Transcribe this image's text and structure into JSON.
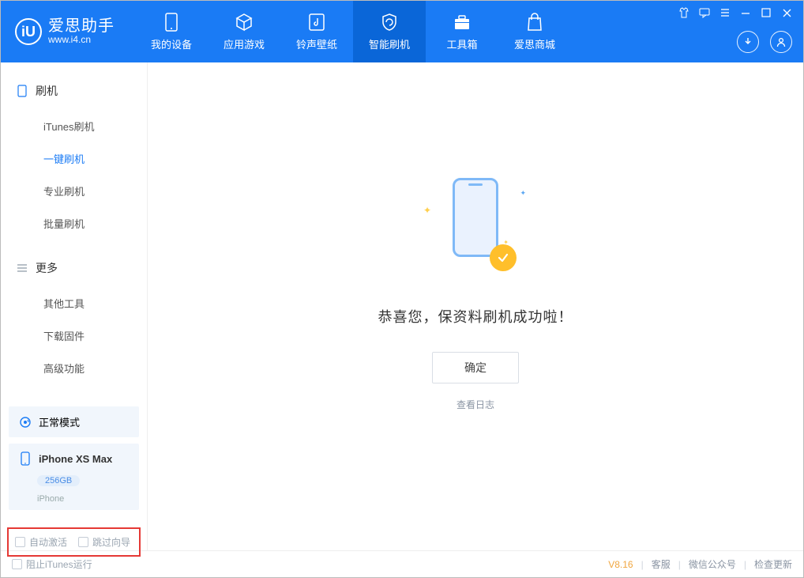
{
  "app": {
    "name": "爱思助手",
    "url": "www.i4.cn"
  },
  "nav": {
    "items": [
      {
        "label": "我的设备"
      },
      {
        "label": "应用游戏"
      },
      {
        "label": "铃声壁纸"
      },
      {
        "label": "智能刷机"
      },
      {
        "label": "工具箱"
      },
      {
        "label": "爱思商城"
      }
    ]
  },
  "sidebar": {
    "section1_title": "刷机",
    "section1_items": [
      "iTunes刷机",
      "一键刷机",
      "专业刷机",
      "批量刷机"
    ],
    "section2_title": "更多",
    "section2_items": [
      "其他工具",
      "下载固件",
      "高级功能"
    ]
  },
  "device": {
    "mode": "正常模式",
    "name": "iPhone XS Max",
    "storage": "256GB",
    "type": "iPhone"
  },
  "options": {
    "auto_activate": "自动激活",
    "skip_guide": "跳过向导"
  },
  "main": {
    "success": "恭喜您，保资料刷机成功啦！",
    "ok": "确定",
    "view_log": "查看日志"
  },
  "footer": {
    "block_itunes": "阻止iTunes运行",
    "version": "V8.16",
    "support": "客服",
    "wechat": "微信公众号",
    "update": "检查更新"
  }
}
